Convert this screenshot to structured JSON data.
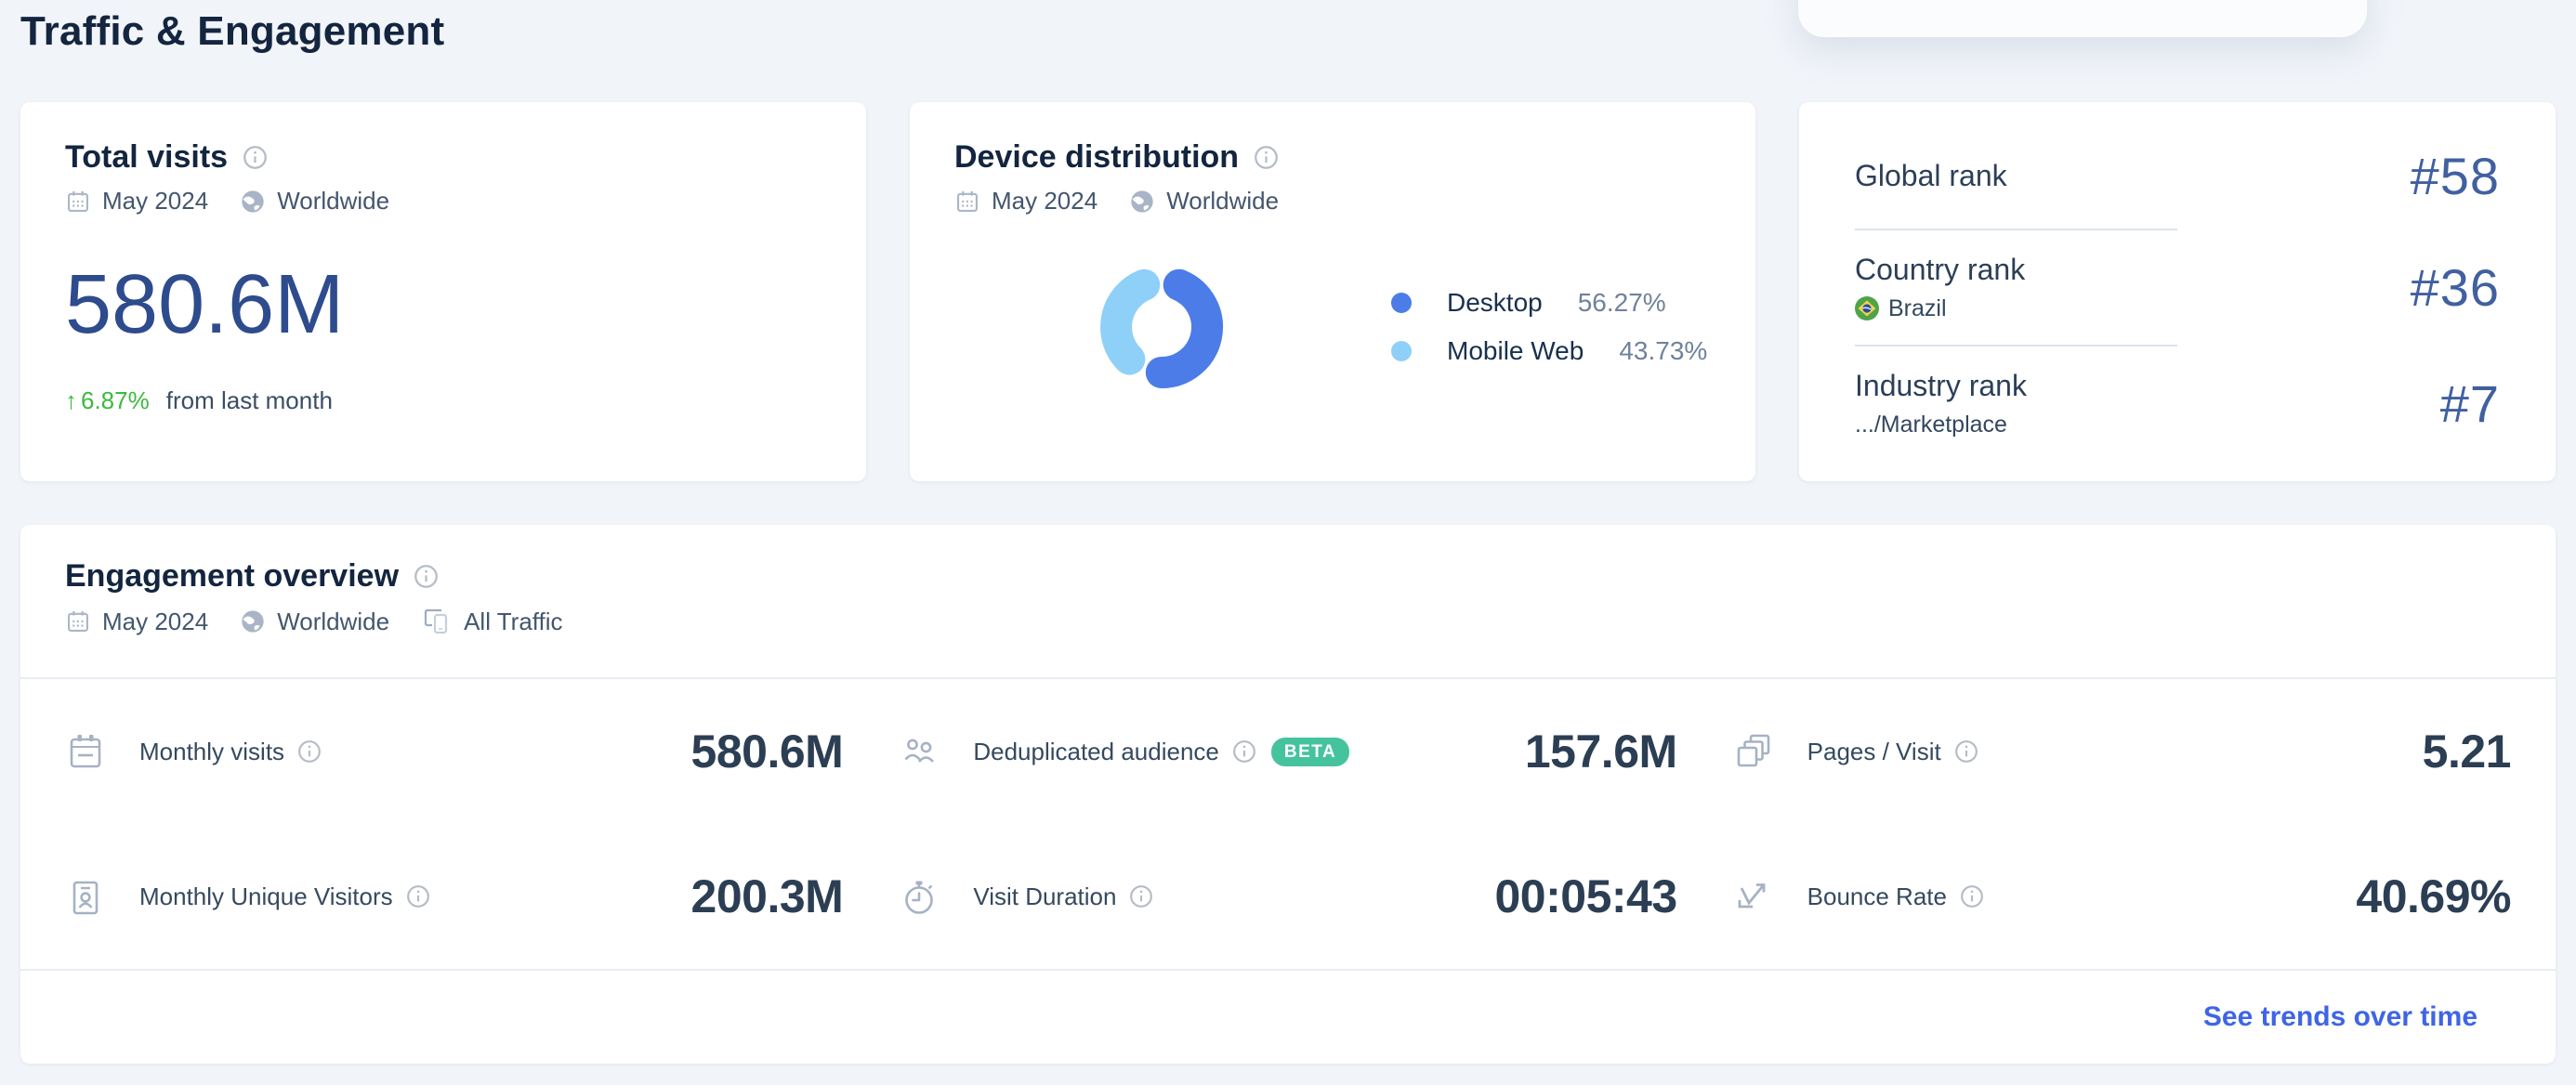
{
  "page": {
    "title": "Traffic & Engagement"
  },
  "cards": {
    "total_visits": {
      "title": "Total visits",
      "period": "May 2024",
      "region": "Worldwide",
      "value": "580.6M",
      "change_arrow": "↑",
      "change": "6.87%",
      "change_direction": "up",
      "change_note": "from last month"
    },
    "device_distribution": {
      "title": "Device distribution",
      "period": "May 2024",
      "region": "Worldwide",
      "legend": [
        {
          "label": "Desktop",
          "value": "56.27%",
          "color": "#4b7ce8"
        },
        {
          "label": "Mobile Web",
          "value": "43.73%",
          "color": "#8fd0f8"
        }
      ]
    },
    "ranks": {
      "rows": [
        {
          "label": "Global rank",
          "value": "#58"
        },
        {
          "label": "Country rank",
          "sublabel": "Brazil",
          "flag": "brazil-flag-icon",
          "value": "#36"
        },
        {
          "label": "Industry rank",
          "sublabel": ".../Marketplace",
          "value": "#7"
        }
      ]
    },
    "engagement": {
      "title": "Engagement overview",
      "period": "May 2024",
      "region": "Worldwide",
      "traffic": "All Traffic",
      "metrics": [
        {
          "label": "Monthly visits",
          "value": "580.6M",
          "icon": "calendar-lines-icon"
        },
        {
          "label": "Deduplicated audience",
          "value": "157.6M",
          "badge": "BETA",
          "icon": "people-icon"
        },
        {
          "label": "Pages / Visit",
          "value": "5.21",
          "icon": "pages-icon"
        },
        {
          "label": "Monthly Unique Visitors",
          "value": "200.3M",
          "icon": "person-badge-icon"
        },
        {
          "label": "Visit Duration",
          "value": "00:05:43",
          "icon": "stopwatch-icon"
        },
        {
          "label": "Bounce Rate",
          "value": "40.69%",
          "icon": "bounce-arrow-icon"
        }
      ],
      "footer_link": "See trends over time"
    }
  },
  "chart_data": {
    "type": "pie",
    "donut": true,
    "title": "Device distribution",
    "categories": [
      "Desktop",
      "Mobile Web"
    ],
    "values": [
      56.27,
      43.73
    ],
    "unit": "%",
    "colors": [
      "#4b7ce8",
      "#8fd0f8"
    ],
    "legend_position": "right"
  },
  "colors": {
    "page_background": "#f1f4f9",
    "card_background": "#ffffff",
    "title_navy": "#13253f",
    "big_number_blue": "#2e4b8e",
    "rank_number_blue": "#41609f",
    "positive_green": "#3cb93f",
    "beta_green": "#45c39d",
    "link_blue": "#3f65e6",
    "icon_gray": "#a6b2c4",
    "desktop_blue": "#4b7ce8",
    "mobile_light_blue": "#8fd0f8"
  }
}
